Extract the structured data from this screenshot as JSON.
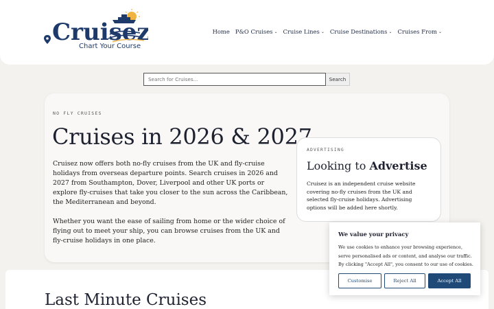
{
  "header": {
    "logo": {
      "brand": "Cruisez",
      "tagline": "Chart Your Course"
    },
    "nav": [
      {
        "label": "Home",
        "dropdown": false
      },
      {
        "label": "P&O Cruises",
        "dropdown": true
      },
      {
        "label": "Cruise Lines",
        "dropdown": true
      },
      {
        "label": "Cruise Destinations",
        "dropdown": true
      },
      {
        "label": "Cruises From",
        "dropdown": true
      }
    ]
  },
  "search": {
    "placeholder": "Search for Cruises...",
    "button_label": "Search"
  },
  "hero": {
    "eyebrow": "NO FLY CRUISES",
    "title": "Cruises in 2026 & 2027",
    "paragraph1": "Cruisez now offers both no-fly cruises from the UK and fly-cruise holidays from overseas departure points. Search cruises in 2026 and 2027 from Southampton, Dover, Liverpool and other UK ports or explore fly-cruises that take you closer to the sun across the Caribbean, the Mediterranean and beyond.",
    "paragraph2": "Whether you want the ease of sailing from home or the wider choice of flying out to meet your ship, you can browse cruises from the UK and fly-cruise holidays in one place."
  },
  "advertising": {
    "eyebrow": "ADVERTISING",
    "title_prefix": "Looking to ",
    "title_bold": "Advertise",
    "text": "Cruisez is an independent cruise website covering no-fly cruises from the UK and selected fly-cruise holidays. Advertising options will be added here shortly."
  },
  "lower": {
    "title": "Last Minute Cruises"
  },
  "cookie_banner": {
    "title": "We value your privacy",
    "text": "We use cookies to enhance your browsing experience, serve personalised ads or content, and analyse our traffic. By clicking \"Accept All\", you consent to our use of cookies.",
    "buttons": {
      "customise": "Customise",
      "reject": "Reject All",
      "accept": "Accept All"
    }
  },
  "colors": {
    "brand_navy": "#1d3a6b",
    "button_blue": "#1f4a78",
    "sun": "#f2b441",
    "page_bg": "#f3f2ee"
  },
  "icons": [
    "map-pin-icon",
    "cruise-ship-icon",
    "sun-icon",
    "chevron-down-icon"
  ]
}
